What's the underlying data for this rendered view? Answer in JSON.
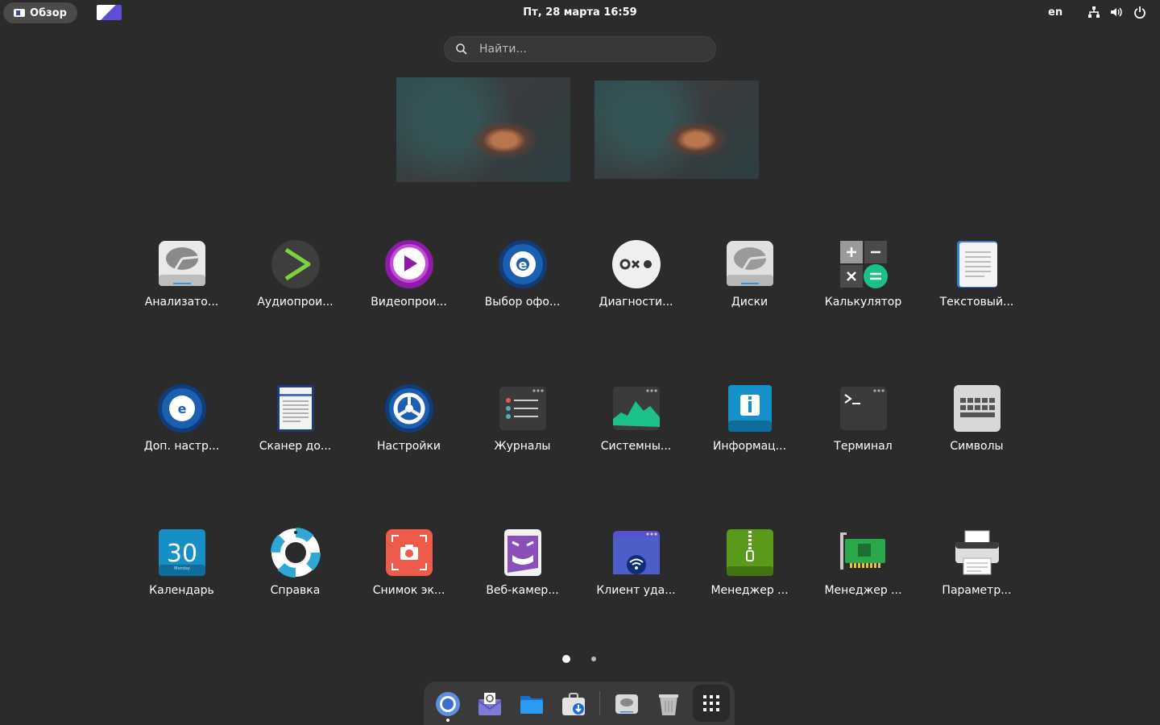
{
  "topbar": {
    "overview_label": "Обзор",
    "clock": "Пт, 28 марта  16:59",
    "lang": "en",
    "tray_icons": [
      "network-icon",
      "volume-icon",
      "power-icon"
    ]
  },
  "search": {
    "placeholder": "Найти..."
  },
  "apps": [
    {
      "label": "Анализато...",
      "icon": "disk-usage-icon"
    },
    {
      "label": "Аудиопрои...",
      "icon": "audio-player-icon"
    },
    {
      "label": "Видеопрои...",
      "icon": "video-player-icon"
    },
    {
      "label": "Выбор офо...",
      "icon": "theme-chooser-icon"
    },
    {
      "label": "Диагности...",
      "icon": "diagnostics-icon"
    },
    {
      "label": "Диски",
      "icon": "disks-icon"
    },
    {
      "label": "Калькулятор",
      "icon": "calculator-icon"
    },
    {
      "label": "Текстовый...",
      "icon": "text-editor-icon"
    },
    {
      "label": "Доп. настр...",
      "icon": "tweaks-icon"
    },
    {
      "label": "Сканер до...",
      "icon": "document-scanner-icon"
    },
    {
      "label": "Настройки",
      "icon": "settings-icon"
    },
    {
      "label": "Журналы",
      "icon": "logs-icon"
    },
    {
      "label": "Системны...",
      "icon": "system-monitor-icon"
    },
    {
      "label": "Информац...",
      "icon": "info-icon"
    },
    {
      "label": "Терминал",
      "icon": "terminal-icon"
    },
    {
      "label": "Символы",
      "icon": "characters-icon"
    },
    {
      "label": "Календарь",
      "icon": "calendar-icon",
      "day": "30",
      "weekday": "Monday"
    },
    {
      "label": "Справка",
      "icon": "help-icon"
    },
    {
      "label": "Снимок эк...",
      "icon": "screenshot-icon"
    },
    {
      "label": "Веб-камер...",
      "icon": "webcam-icon"
    },
    {
      "label": "Клиент уда...",
      "icon": "remote-desktop-icon"
    },
    {
      "label": "Менеджер ...",
      "icon": "archive-manager-icon"
    },
    {
      "label": "Менеджер ...",
      "icon": "device-manager-icon"
    },
    {
      "label": "Параметр...",
      "icon": "printer-settings-icon"
    }
  ],
  "pager": {
    "pages": 2,
    "current": 1
  },
  "dock": {
    "items": [
      "chromium-browser-icon",
      "mail-client-icon",
      "files-icon",
      "software-store-icon",
      "disk-image-icon",
      "trash-icon",
      "app-grid-icon"
    ]
  }
}
